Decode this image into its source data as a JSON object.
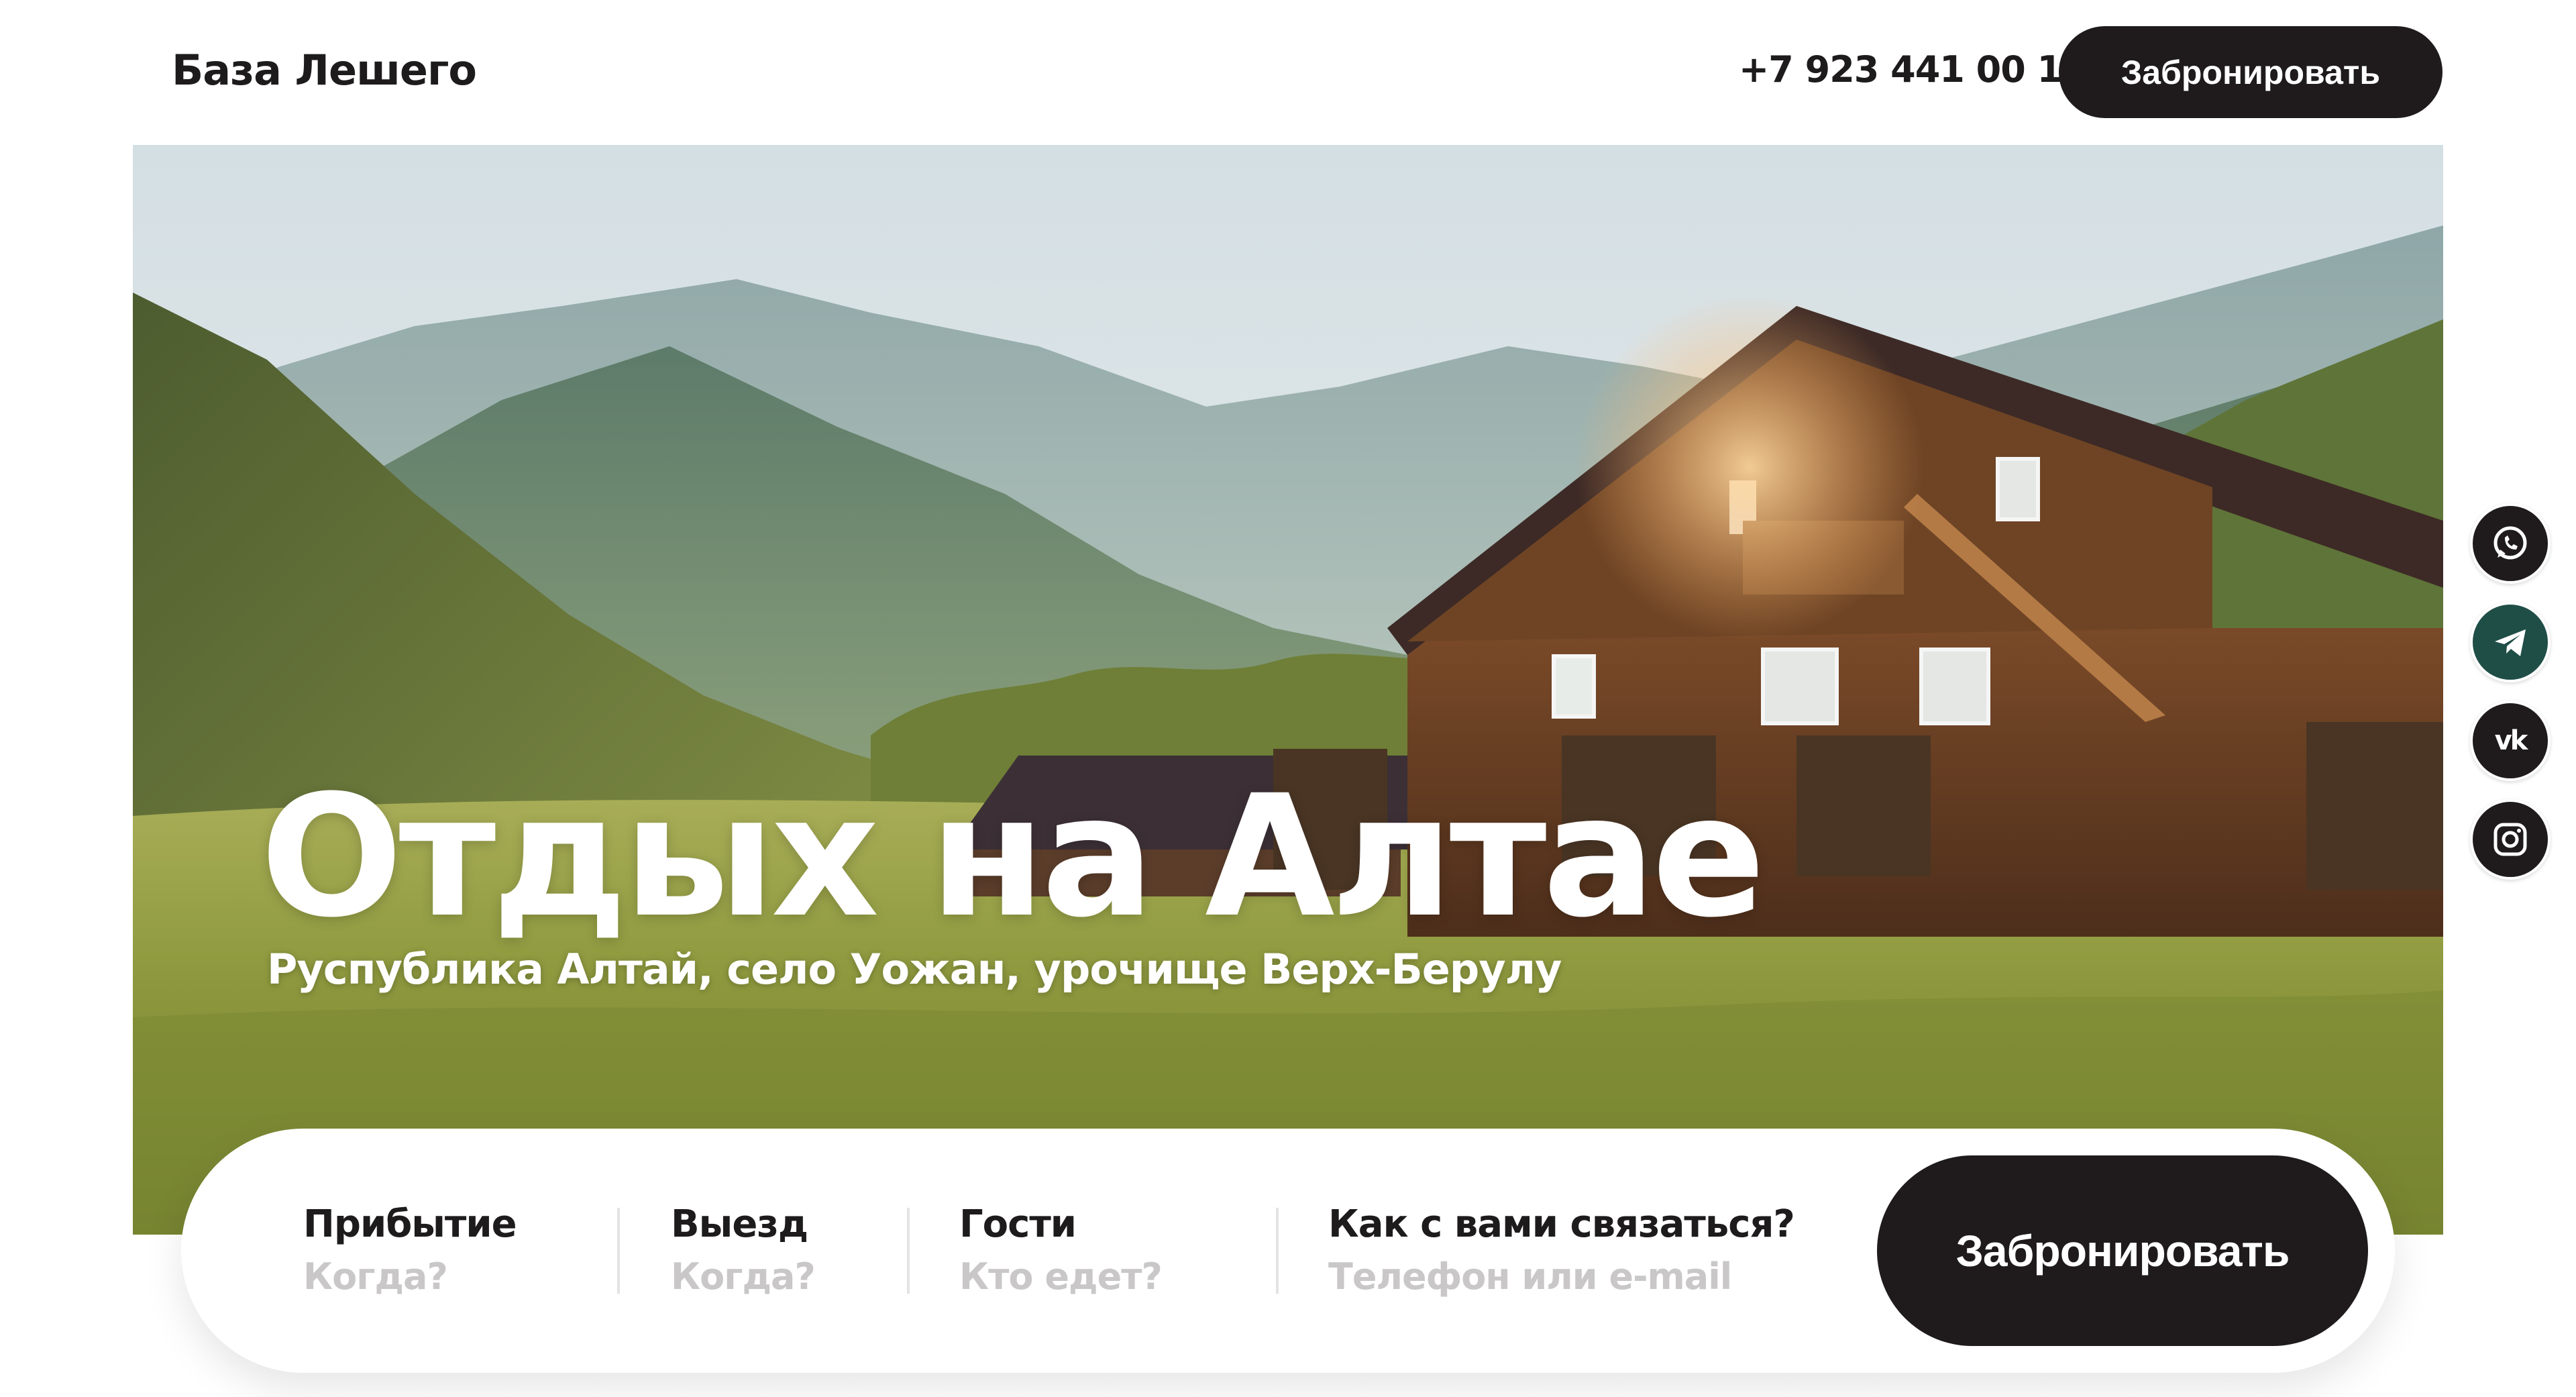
{
  "header": {
    "logo": "База Лешего",
    "phone": "+7 923 441 00 11",
    "book_label": "Забронировать"
  },
  "hero": {
    "title": "Отдых на Алтае",
    "subtitle": "Руспублика Алтай, село Уожан, урочище Верх-Берулу"
  },
  "social": [
    {
      "icon": "whatsapp-icon",
      "color": "#1f1b1d"
    },
    {
      "icon": "telegram-icon",
      "color": "#1f4e47"
    },
    {
      "icon": "vk-icon",
      "label": "vk",
      "color": "#1f1b1d"
    },
    {
      "icon": "instagram-icon",
      "color": "#1f1b1d"
    }
  ],
  "booking": {
    "fields": [
      {
        "label": "Прибытие",
        "placeholder": "Когда?"
      },
      {
        "label": "Выезд",
        "placeholder": "Когда?"
      },
      {
        "label": "Гости",
        "placeholder": "Кто едет?"
      },
      {
        "label": "Как с вами связаться?",
        "placeholder": "Телефон или e-mail"
      }
    ],
    "submit_label": "Забронировать"
  },
  "colors": {
    "primary_dark": "#1f1b1d",
    "telegram_active": "#1f4e47",
    "placeholder": "#c9c7c7"
  }
}
